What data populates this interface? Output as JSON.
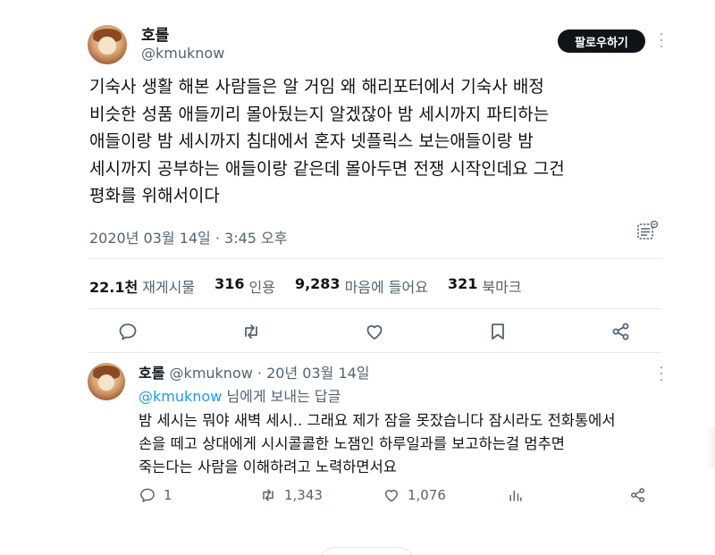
{
  "main_tweet": {
    "author_name": "호롤",
    "author_handle": "@kmuknow",
    "follow_label": "팔로우하기",
    "text_lines": [
      "기숙사 생활 해본 사람들은 알 거임 왜 해리포터에서 기숙사 배정",
      "비슷한 성품 애들끼리 몰아뒀는지 알겠잖아 밤 세시까지 파티하는",
      "애들이랑 밤 세시까지 침대에서 혼자 넷플릭스 보는애들이랑 밤",
      "세시까지 공부하는 애들이랑 같은데 몰아두면 전쟁 시작인데요 그건",
      "평화를 위해서이다"
    ],
    "timestamp": "2020년 03월 14일 · 3:45 오후",
    "stats": [
      {
        "value": "22.1천",
        "label": "재게시물"
      },
      {
        "value": "316",
        "label": "인용"
      },
      {
        "value": "9,283",
        "label": "마음에 들어요"
      },
      {
        "value": "321",
        "label": "북마크"
      }
    ],
    "actions": [
      "reply-icon",
      "retweet-icon",
      "like-icon",
      "bookmark-icon",
      "share-icon"
    ]
  },
  "reply_tweet": {
    "author_name": "호롤",
    "author_handle": "@kmuknow",
    "separator": "·",
    "date": "20년 03월 14일",
    "replying_mention": "@kmuknow",
    "replying_suffix": "님에게 보내는 답글",
    "text_lines": [
      "밤 세시는 뭐야 새벽 세시.. 그래요 제가 잠을 못잤습니다 잠시라도 전화통에서",
      "손을 떼고 상대에게 시시콜콜한 노잼인 하루일과를 보고하는걸 멈추면",
      "죽는다는 사람을 이해하려고 노력하면서요"
    ],
    "reply_count": "1",
    "retweet_count": "1,343",
    "like_count": "1,076"
  },
  "colors": {
    "text": "#0f1419",
    "muted": "#536471",
    "link": "#1d9bf0",
    "divider": "#e3e7ea",
    "button_bg": "#0f1419"
  }
}
